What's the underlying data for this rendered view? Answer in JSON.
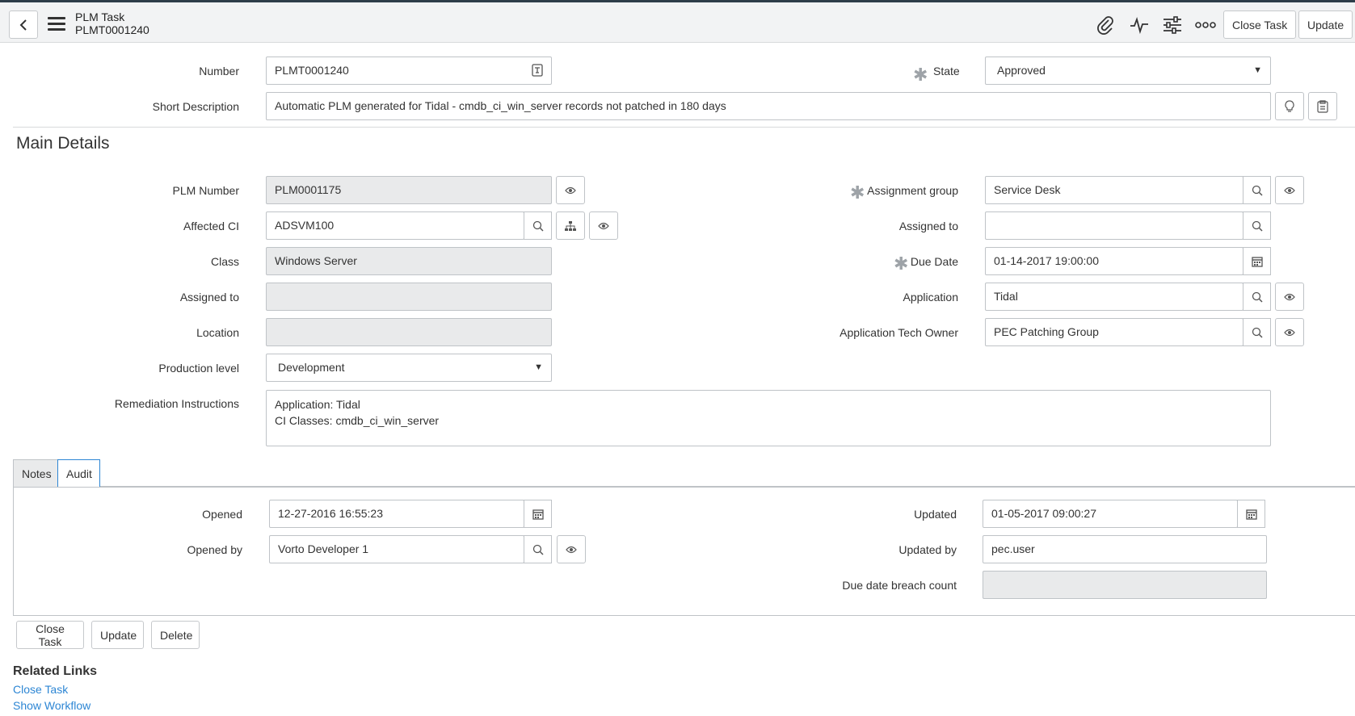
{
  "header": {
    "title": "PLM Task",
    "record_number": "PLMT0001240",
    "close_task_label": "Close Task",
    "update_label": "Update",
    "icons": [
      "paperclip-icon",
      "activity-icon",
      "sliders-icon",
      "more-icon"
    ]
  },
  "top_form": {
    "number_label": "Number",
    "number_value": "PLMT0001240",
    "state_label": "State",
    "state_value": "Approved",
    "short_desc_label": "Short Description",
    "short_desc_value": "Automatic PLM generated for Tidal - cmdb_ci_win_server records not patched in 180 days"
  },
  "main_details": {
    "section_title": "Main Details",
    "plm_number_label": "PLM Number",
    "plm_number_value": "PLM0001175",
    "affected_ci_label": "Affected CI",
    "affected_ci_value": "ADSVM100",
    "class_label": "Class",
    "class_value": "Windows Server",
    "assigned_to_left_label": "Assigned to",
    "assigned_to_left_value": "",
    "location_label": "Location",
    "location_value": "",
    "production_level_label": "Production level",
    "production_level_value": "Development",
    "assignment_group_label": "Assignment group",
    "assignment_group_value": "Service Desk",
    "assigned_to_right_label": "Assigned to",
    "assigned_to_right_value": "",
    "due_date_label": "Due Date",
    "due_date_value": "01-14-2017 19:00:00",
    "application_label": "Application",
    "application_value": "Tidal",
    "app_tech_owner_label": "Application Tech Owner",
    "app_tech_owner_value": "PEC Patching Group",
    "remediation_label": "Remediation Instructions",
    "remediation_line1": "Application: Tidal",
    "remediation_line2": "CI Classes: cmdb_ci_win_server"
  },
  "tabs": [
    {
      "label": "Notes",
      "active": false
    },
    {
      "label": "Audit",
      "active": true
    }
  ],
  "audit": {
    "opened_label": "Opened",
    "opened_value": "12-27-2016 16:55:23",
    "opened_by_label": "Opened by",
    "opened_by_value": "Vorto Developer 1",
    "updated_label": "Updated",
    "updated_value": "01-05-2017 09:00:27",
    "updated_by_label": "Updated by",
    "updated_by_value": "pec.user",
    "breach_label": "Due date breach count",
    "breach_value": ""
  },
  "footer_buttons": {
    "close_task": "Close Task",
    "update": "Update",
    "delete": "Delete"
  },
  "related_links": {
    "title": "Related Links",
    "close_task": "Close Task",
    "show_workflow": "Show Workflow"
  },
  "colors": {
    "link": "#2d86d4",
    "header_bg": "#f2f3f4",
    "readonly_bg": "#e9eaeb"
  }
}
